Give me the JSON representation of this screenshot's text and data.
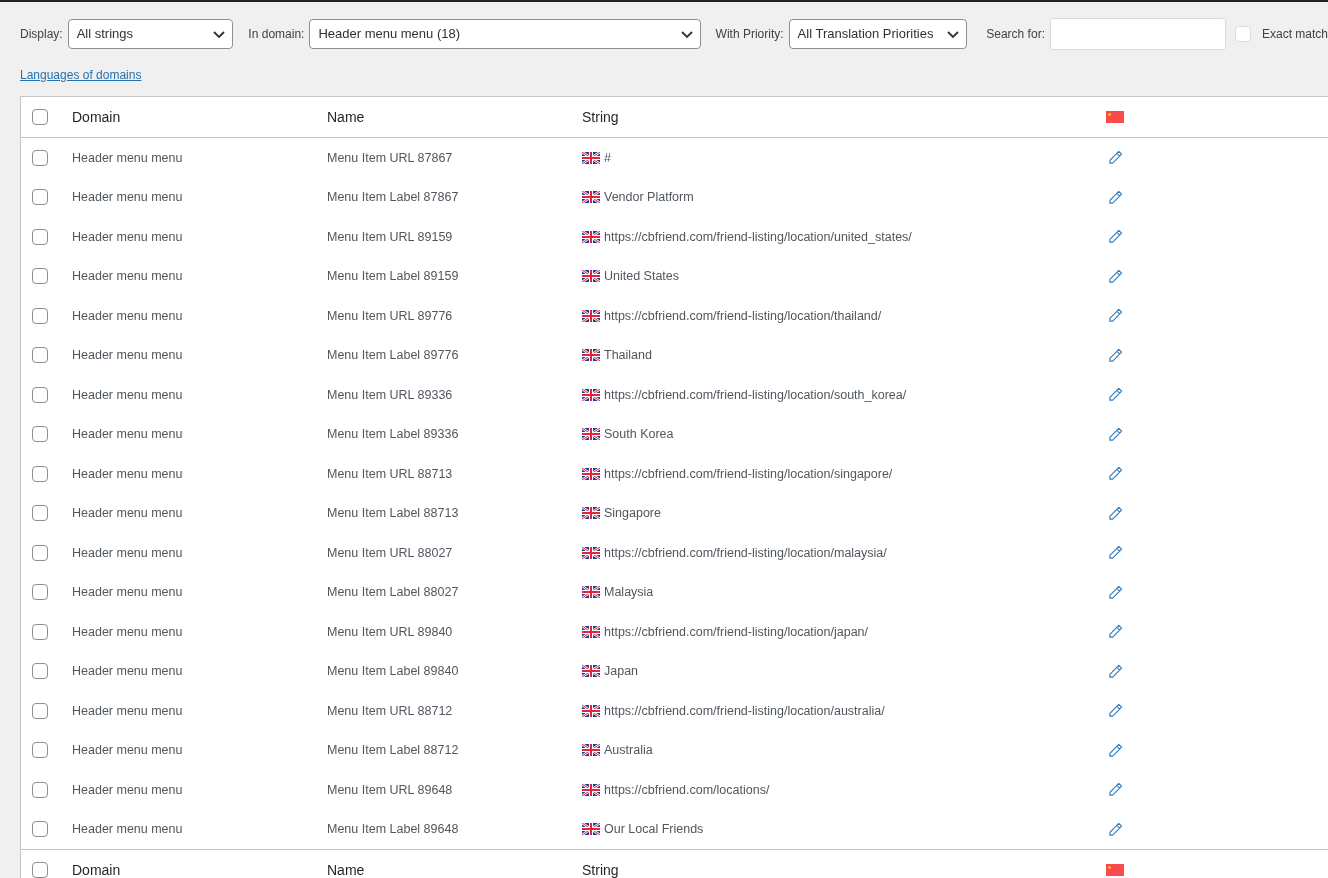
{
  "filters": {
    "display": {
      "label": "Display:",
      "value": "All strings"
    },
    "domain": {
      "label": "In domain:",
      "value": "Header menu menu (18)"
    },
    "priority": {
      "label": "With Priority:",
      "value": "All Translation Priorities"
    },
    "search": {
      "label": "Search for:"
    },
    "exact_match": {
      "label": "Exact match",
      "checked": false
    }
  },
  "languages_link": "Languages of domains",
  "table": {
    "select_all_checked": false,
    "footer_select_all_checked": false,
    "columns": [
      "Domain",
      "Name",
      "String"
    ],
    "rows": [
      {
        "domain": "Header menu menu",
        "name": "Menu Item URL 87867",
        "string": "#",
        "checked": false
      },
      {
        "domain": "Header menu menu",
        "name": "Menu Item Label 87867",
        "string": "Vendor Platform",
        "checked": false
      },
      {
        "domain": "Header menu menu",
        "name": "Menu Item URL 89159",
        "string": "https://cbfriend.com/friend-listing/location/united_states/",
        "checked": false
      },
      {
        "domain": "Header menu menu",
        "name": "Menu Item Label 89159",
        "string": "United States",
        "checked": false
      },
      {
        "domain": "Header menu menu",
        "name": "Menu Item URL 89776",
        "string": "https://cbfriend.com/friend-listing/location/thailand/",
        "checked": false
      },
      {
        "domain": "Header menu menu",
        "name": "Menu Item Label 89776",
        "string": "Thailand",
        "checked": false
      },
      {
        "domain": "Header menu menu",
        "name": "Menu Item URL 89336",
        "string": "https://cbfriend.com/friend-listing/location/south_korea/",
        "checked": false
      },
      {
        "domain": "Header menu menu",
        "name": "Menu Item Label 89336",
        "string": "South Korea",
        "checked": false
      },
      {
        "domain": "Header menu menu",
        "name": "Menu Item URL 88713",
        "string": "https://cbfriend.com/friend-listing/location/singapore/",
        "checked": false
      },
      {
        "domain": "Header menu menu",
        "name": "Menu Item Label 88713",
        "string": "Singapore",
        "checked": false
      },
      {
        "domain": "Header menu menu",
        "name": "Menu Item URL 88027",
        "string": "https://cbfriend.com/friend-listing/location/malaysia/",
        "checked": false
      },
      {
        "domain": "Header menu menu",
        "name": "Menu Item Label 88027",
        "string": "Malaysia",
        "checked": false
      },
      {
        "domain": "Header menu menu",
        "name": "Menu Item URL 89840",
        "string": "https://cbfriend.com/friend-listing/location/japan/",
        "checked": false
      },
      {
        "domain": "Header menu menu",
        "name": "Menu Item Label 89840",
        "string": "Japan",
        "checked": false
      },
      {
        "domain": "Header menu menu",
        "name": "Menu Item URL 88712",
        "string": "https://cbfriend.com/friend-listing/location/australia/",
        "checked": false
      },
      {
        "domain": "Header menu menu",
        "name": "Menu Item Label 88712",
        "string": "Australia",
        "checked": false
      },
      {
        "domain": "Header menu menu",
        "name": "Menu Item URL 89648",
        "string": "https://cbfriend.com/locations/",
        "checked": false
      },
      {
        "domain": "Header menu menu",
        "name": "Menu Item Label 89648",
        "string": "Our Local Friends",
        "checked": false
      }
    ],
    "footer_columns": [
      "Domain",
      "Name",
      "String"
    ]
  }
}
